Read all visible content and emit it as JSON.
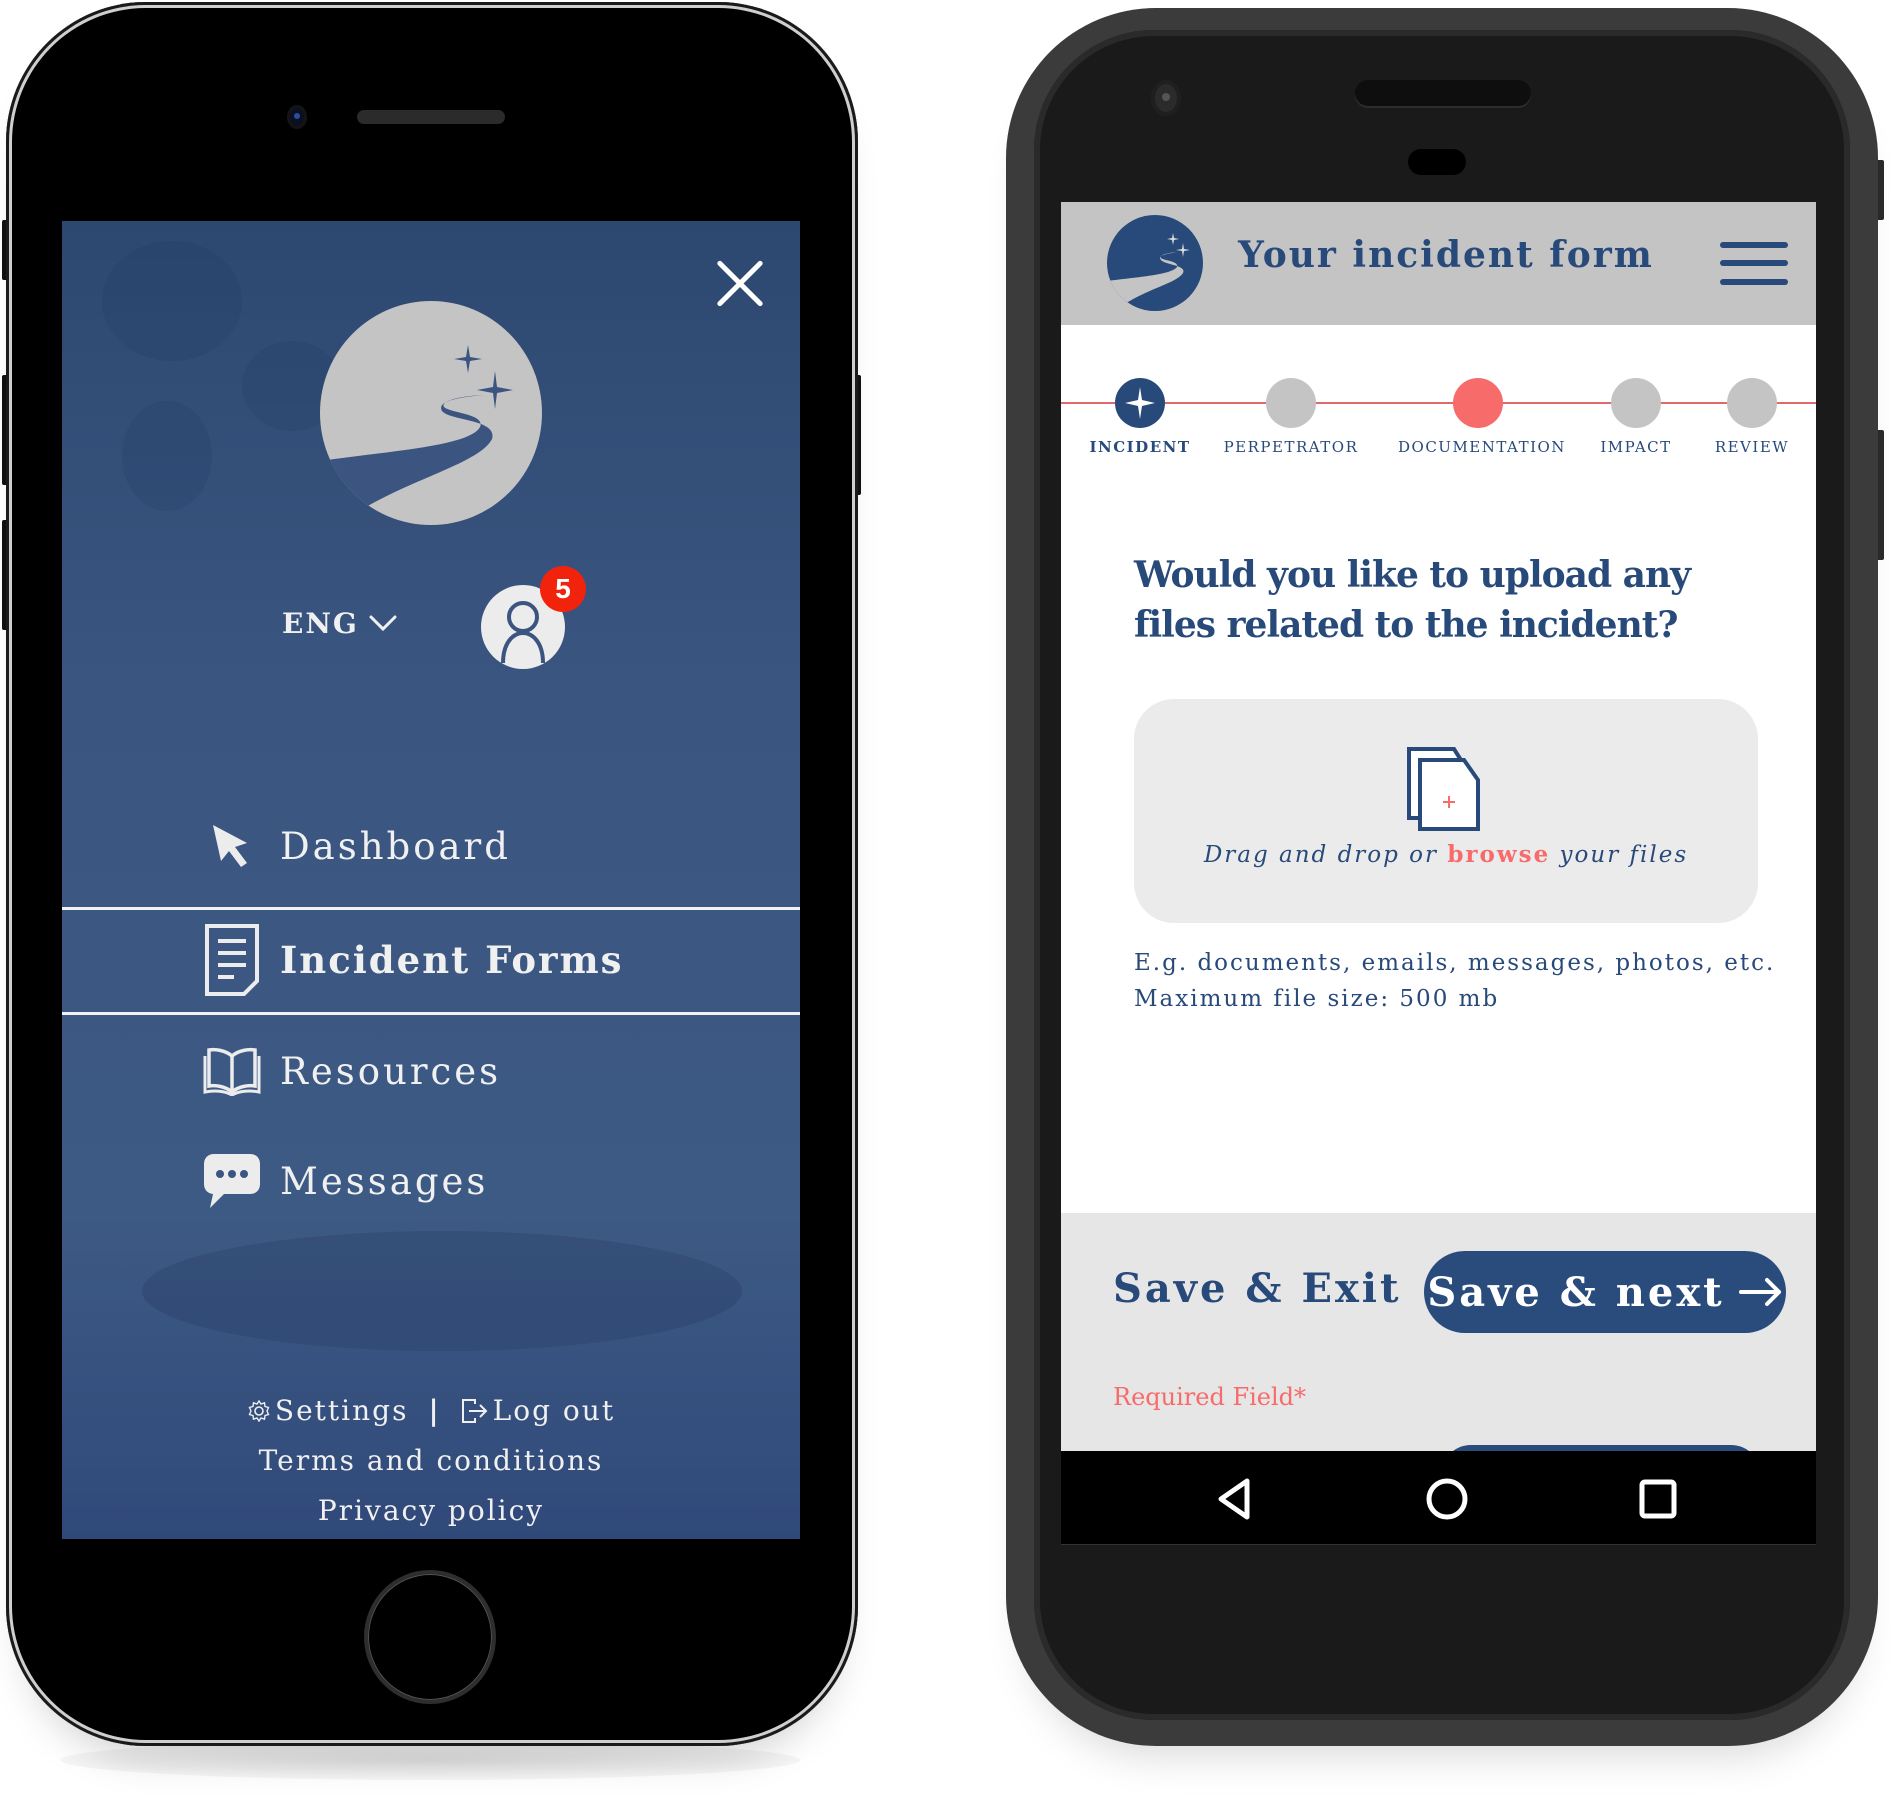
{
  "colors": {
    "brand_navy": "#284a7a",
    "menu_background": "#3b5580",
    "accent_coral": "#f76b6b",
    "badge_red": "#f2230d",
    "header_gray": "#c4c4c4",
    "footer_gray": "#e6e6e6"
  },
  "menu_screen": {
    "close_icon": "close-icon",
    "logo_icon": "moon-path-stars-logo",
    "language": {
      "label": "ENG",
      "icon": "chevron-down-icon"
    },
    "profile": {
      "icon": "user-avatar-icon",
      "notification_count": "5"
    },
    "nav_items": [
      {
        "label": "Dashboard",
        "icon": "cursor-arrow-icon",
        "active": false
      },
      {
        "label": "Incident Forms",
        "icon": "document-icon",
        "active": true
      },
      {
        "label": "Resources",
        "icon": "open-book-icon",
        "active": false
      },
      {
        "label": "Messages",
        "icon": "chat-bubble-icon",
        "active": false
      }
    ],
    "footer": {
      "settings_label": "Settings",
      "settings_icon": "gear-icon",
      "separator": "|",
      "logout_label": "Log out",
      "logout_icon": "logout-icon",
      "terms_label": "Terms and conditions",
      "privacy_label": "Privacy policy"
    }
  },
  "form_screen": {
    "header": {
      "title": "Your incident form",
      "logo_icon": "moon-path-stars-logo",
      "menu_icon": "hamburger-icon"
    },
    "steps": [
      {
        "label": "INCIDENT",
        "state": "current"
      },
      {
        "label": "PERPETRATOR",
        "state": "pending"
      },
      {
        "label": "DOCUMENTATION",
        "state": "highlighted"
      },
      {
        "label": "IMPACT",
        "state": "pending"
      },
      {
        "label": "REVIEW",
        "state": "pending"
      }
    ],
    "question": "Would you like to upload any files related to the incident?",
    "upload": {
      "icon": "file-add-icon",
      "text_before": "Drag and drop or ",
      "link_label": "browse",
      "text_after": " your files"
    },
    "hints": [
      "E.g. documents, emails, messages, photos, etc.",
      "Maximum file size: 500 mb"
    ],
    "actions": {
      "save_exit_label": "Save & Exit",
      "save_next_label": "Save & next",
      "save_next_icon": "arrow-right-icon"
    },
    "required_note": "Required Field*",
    "android_nav": {
      "back_icon": "back-triangle-icon",
      "home_icon": "home-circle-icon",
      "recents_icon": "recents-square-icon"
    }
  }
}
